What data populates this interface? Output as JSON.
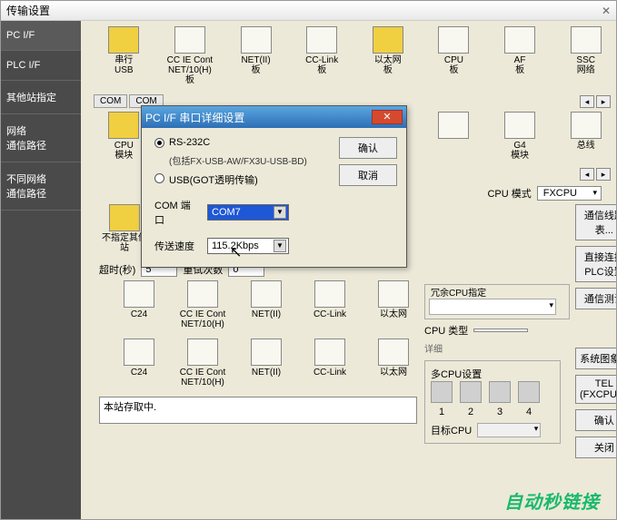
{
  "window": {
    "title": "传输设置",
    "close": "✕"
  },
  "leftnav": [
    "PC I/F",
    "PLC I/F",
    "其他站指定",
    "网络\n通信路径",
    "不同网络\n通信路径"
  ],
  "top_icons": [
    {
      "label": "串行\nUSB",
      "yellow": true
    },
    {
      "label": "CC IE Cont\nNET/10(H)板"
    },
    {
      "label": "NET(II)\n板"
    },
    {
      "label": "CC-Link\n板"
    },
    {
      "label": "以太网\n板",
      "yellow": true
    },
    {
      "label": "CPU\n板"
    },
    {
      "label": "AF\n板"
    },
    {
      "label": "SSC\n网络"
    }
  ],
  "tabs": [
    "COM",
    "COM"
  ],
  "scroll_arrows": [
    "◂",
    "▸"
  ],
  "row2_icons": [
    {
      "label": "CPU\n模块",
      "yellow": true
    },
    {
      "label": ""
    },
    {
      "label": ""
    },
    {
      "label": ""
    },
    {
      "label": ""
    },
    {
      "label": ""
    },
    {
      "label": "G4\n模块"
    },
    {
      "label": "总线"
    }
  ],
  "cpu_mode": {
    "label": "CPU 模式",
    "value": "FXCPU"
  },
  "station_icon": {
    "label": "不指定其他站",
    "yellow": true
  },
  "timeout": {
    "label": "超时(秒)",
    "value": "5",
    "retry_label": "重试次数",
    "retry_value": "0"
  },
  "redundant": {
    "legend": "冗余CPU指定"
  },
  "route1_icons": [
    "C24",
    "CC IE Cont\nNET/10(H)",
    "NET(II)",
    "CC-Link",
    "以太网"
  ],
  "route2_icons": [
    "C24",
    "CC IE Cont\nNET/10(H)",
    "NET(II)",
    "CC-Link",
    "以太网"
  ],
  "multi_cpu": {
    "legend": "多CPU设置",
    "nums": [
      "1",
      "2",
      "3",
      "4"
    ],
    "target": "目标CPU"
  },
  "cpu_type": {
    "label": "CPU 类型",
    "detail": "详细"
  },
  "right_buttons": [
    "通信线路表...",
    "直接连接PLC设置",
    "通信测试",
    "系统图象...",
    "TEL (FXCPU)...",
    "确认",
    "关闭"
  ],
  "status": "本站存取中.",
  "watermark": "自动秒链接",
  "modal": {
    "title": "PC I/F 串口详细设置",
    "radio1": "RS-232C",
    "radio1_sub": "(包括FX-USB-AW/FX3U-USB-BD)",
    "radio2": "USB(GOT透明传输)",
    "com_label": "COM 端口",
    "com_value": "COM7",
    "speed_label": "传送速度",
    "speed_value": "115.2Kbps",
    "ok": "确认",
    "cancel": "取消"
  }
}
